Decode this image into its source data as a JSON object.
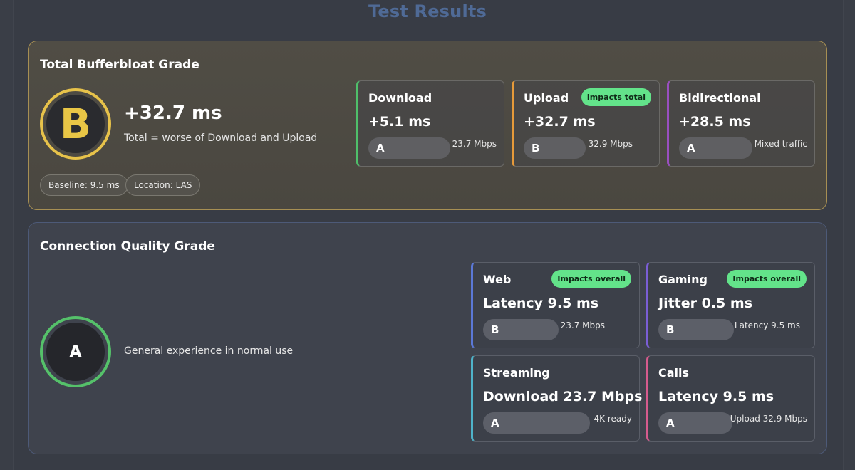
{
  "page_title": "Test Results",
  "bufferbloat": {
    "title": "Total Bufferbloat Grade",
    "grade": "B",
    "value": "+32.7 ms",
    "subtitle": "Total = worse of Download and Upload",
    "baseline": "Baseline: 9.5 ms",
    "location": "Location: LAS",
    "colors": {
      "border": "#a78f53",
      "grade": "#e9c646"
    },
    "cards": [
      {
        "title": "Download",
        "value": "+5.1 ms",
        "grade": "A",
        "note": "23.7 Mbps",
        "badge": "",
        "accent": "#4fbf6a"
      },
      {
        "title": "Upload",
        "value": "+32.7 ms",
        "grade": "B",
        "note": "32.9 Mbps",
        "badge": "Impacts total",
        "accent": "#e69a3a"
      },
      {
        "title": "Bidirectional",
        "value": "+28.5 ms",
        "grade": "A",
        "note": "Mixed traffic",
        "badge": "",
        "accent": "#9a4fbf"
      }
    ]
  },
  "quality": {
    "title": "Connection Quality Grade",
    "grade": "A",
    "subtitle": "General experience in normal use",
    "colors": {
      "border": "#4d5a78",
      "grade": "#55c16a"
    },
    "cards": [
      {
        "title": "Web",
        "value": "Latency 9.5 ms",
        "grade": "B",
        "note": "23.7 Mbps",
        "badge": "Impacts overall",
        "accent": "#5b78d6"
      },
      {
        "title": "Gaming",
        "value": "Jitter 0.5 ms",
        "grade": "B",
        "note": "Latency 9.5 ms",
        "badge": "Impacts overall",
        "accent": "#7a5ed6"
      },
      {
        "title": "Streaming",
        "value": "Download 23.7 Mbps",
        "grade": "A",
        "note": "4K ready",
        "badge": "",
        "accent": "#4fb3c9"
      },
      {
        "title": "Calls",
        "value": "Latency 9.5 ms",
        "grade": "A",
        "note": "Upload 32.9 Mbps",
        "badge": "",
        "accent": "#d65b8e"
      }
    ]
  },
  "badge_color": "#63e38a"
}
